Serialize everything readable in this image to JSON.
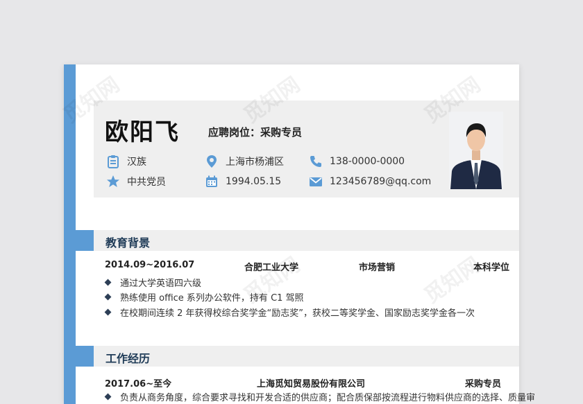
{
  "header": {
    "name": "欧阳飞",
    "position": "应聘岗位：采购专员",
    "info": {
      "ethnicity": "汉族",
      "location": "上海市杨浦区",
      "phone": "138-0000-0000",
      "party": "中共党员",
      "birth": "1994.05.15",
      "email": "123456789@qq.com"
    },
    "icon_color": "#5b9bd5"
  },
  "education": {
    "title": "教育背景",
    "period": "2014.09~2016.07",
    "school": "合肥工业大学",
    "major": "市场营销",
    "degree": "本科学位",
    "bullets": [
      "通过大学英语四六级",
      "熟练使用 office 系列办公软件，持有 C1 驾照",
      "在校期间连续 2 年获得校综合奖学金“励志奖”，获校二等奖学金、国家励志奖学金各一次"
    ]
  },
  "work": {
    "title": "工作经历",
    "period": "2017.06~至今",
    "company": "上海觅知贸易股份有限公司",
    "role": "采购专员",
    "bullets": [
      "负责从商务角度，综合要求寻找和开发合适的供应商；配合质保部按流程进行物料供应商的选择、质量审"
    ]
  },
  "watermark": "觅知网",
  "colors": {
    "accent": "#5b9bd5",
    "section_bg": "#efefef",
    "title": "#1f3b57"
  }
}
